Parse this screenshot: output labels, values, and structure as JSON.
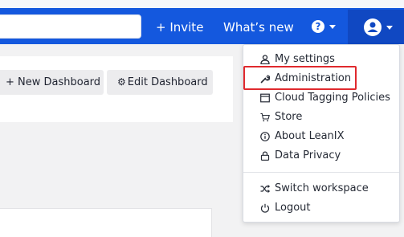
{
  "topbar": {
    "invite_label": "+ Invite",
    "whatsnew_label": "What’s new",
    "help_label": "?",
    "brand_color": "#1458de",
    "user_menu_color": "#1048c2"
  },
  "toolbar": {
    "new_dashboard_label": "+ New Dashboard",
    "edit_dashboard_label": "Edit Dashboard"
  },
  "user_menu": {
    "items": [
      {
        "label": "My settings",
        "icon": "user-icon"
      },
      {
        "label": "Administration",
        "icon": "wrench-icon"
      },
      {
        "label": "Cloud Tagging Policies",
        "icon": "window-icon"
      },
      {
        "label": "Store",
        "icon": "cart-icon"
      },
      {
        "label": "About LeanIX",
        "icon": "info-icon"
      },
      {
        "label": "Data Privacy",
        "icon": "lock-icon"
      },
      {
        "label": "Switch workspace",
        "icon": "shuffle-icon"
      },
      {
        "label": "Logout",
        "icon": "power-icon"
      }
    ],
    "highlight_color": "#e0292e"
  }
}
